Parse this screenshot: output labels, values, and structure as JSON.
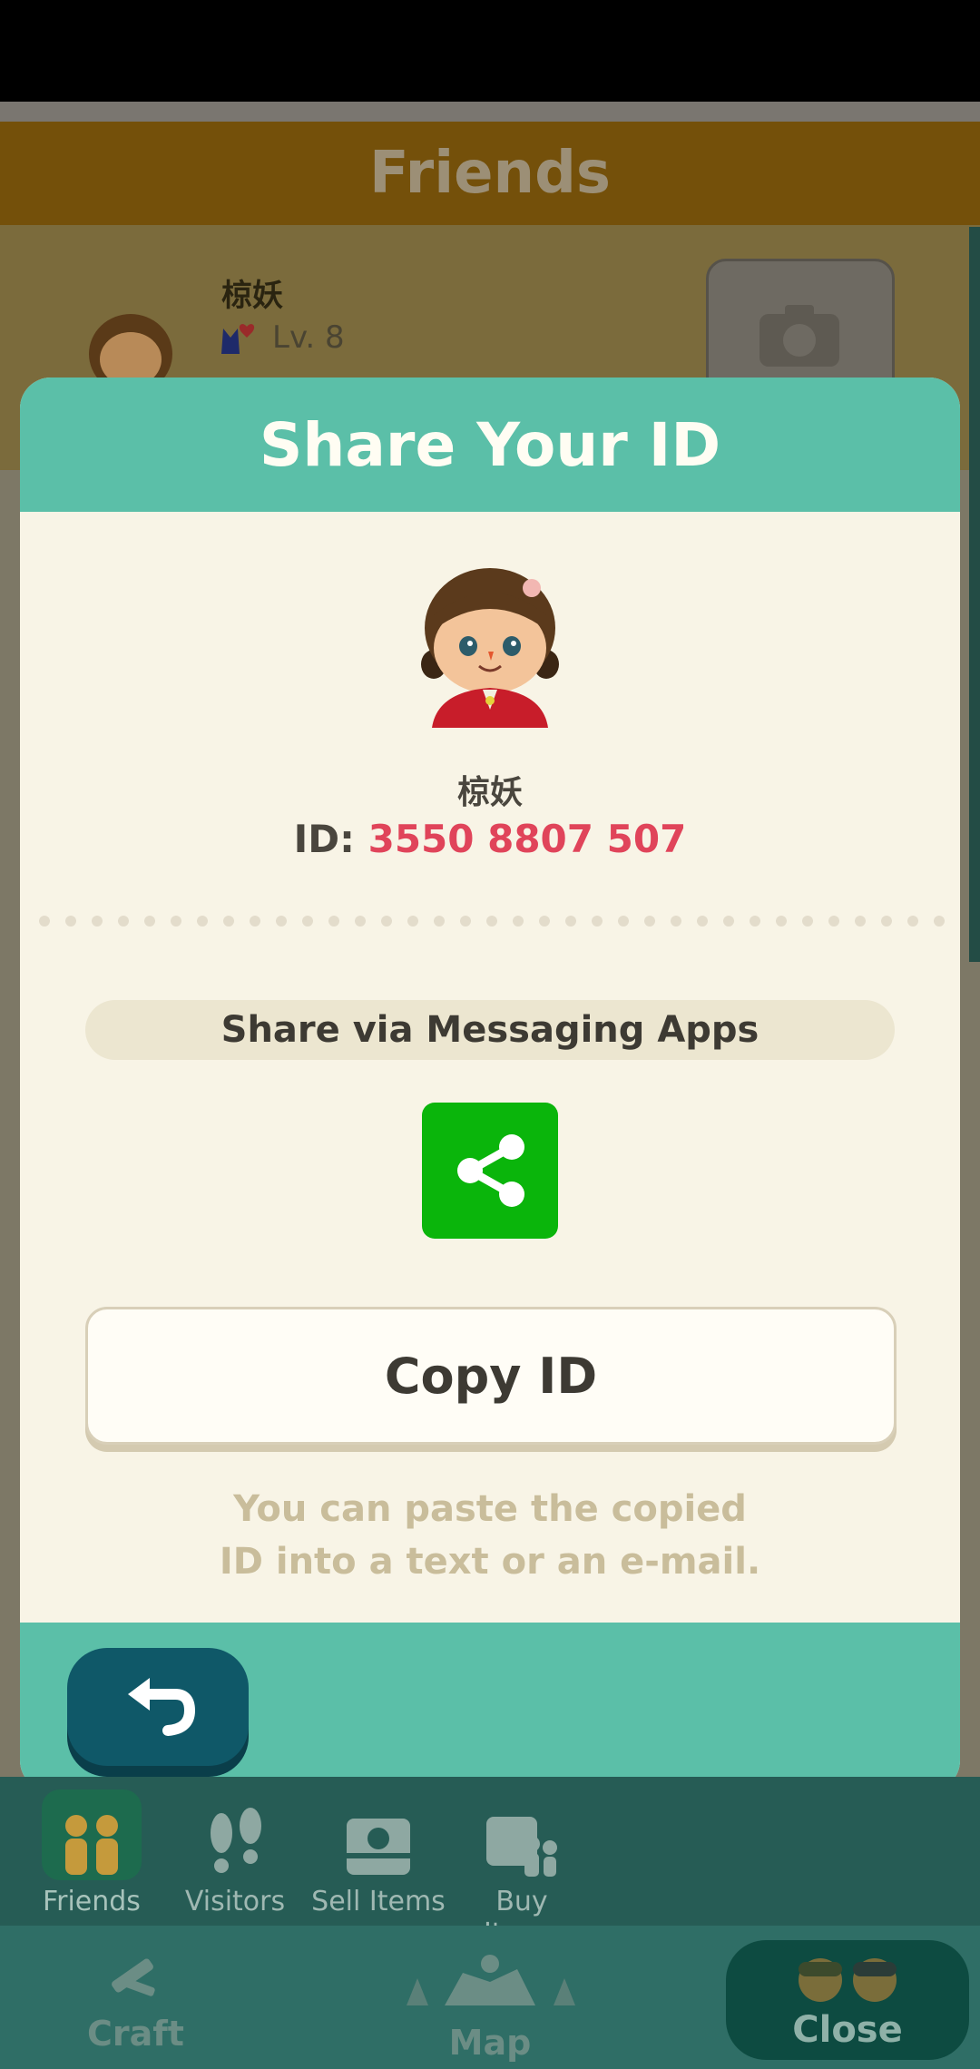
{
  "screen": {
    "header_title": "Friends",
    "friend": {
      "name": "椋妖",
      "level": "Lv. 8"
    }
  },
  "dialog": {
    "title": "Share Your ID",
    "player_name": "椋妖",
    "id_label": "ID:",
    "id_value": "3550 8807 507",
    "share_label": "Share via Messaging Apps",
    "share_icon": "share-icon",
    "copy_button": "Copy ID",
    "hint_line1": "You can paste the copied",
    "hint_line2": "ID into a text or an e-mail.",
    "back_icon": "back-arrow-icon"
  },
  "tabs": [
    {
      "label": "Friends",
      "icon": "friends-icon",
      "active": true
    },
    {
      "label": "Visitors",
      "icon": "footprints-icon",
      "active": false
    },
    {
      "label": "Sell Items",
      "icon": "sell-box-icon",
      "active": false
    },
    {
      "label": "Buy Items",
      "icon": "buy-items-icon",
      "active": false
    }
  ],
  "nav": {
    "craft": "Craft",
    "map": "Map",
    "close": "Close"
  },
  "colors": {
    "accent": "#5bbfa8",
    "id_value": "#e0445a",
    "share_green": "#0ab50b",
    "back_button": "#0f5868"
  }
}
